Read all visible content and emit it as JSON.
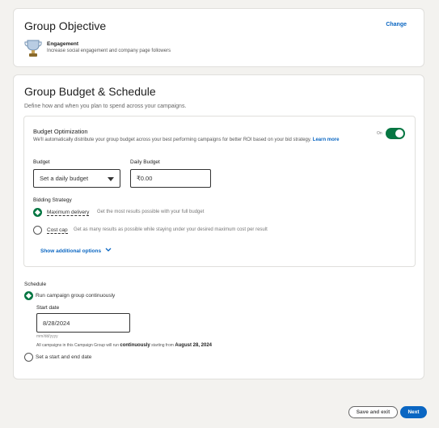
{
  "objective": {
    "title": "Group Objective",
    "change_label": "Change",
    "item_title": "Engagement",
    "item_desc": "Increase social engagement and company page followers"
  },
  "budget": {
    "title": "Group Budget & Schedule",
    "subtitle": "Define how and when you plan to spend across your campaigns.",
    "optimization": {
      "title": "Budget Optimization",
      "desc": "We'll automatically distribute your group budget across your best performing campaigns for better ROI based on your bid strategy.",
      "learn_more": "Learn more",
      "toggle_label": "On",
      "toggle_on": true
    },
    "budget_label": "Budget",
    "budget_select": "Set a daily budget",
    "daily_label": "Daily Budget",
    "daily_value": "₹0.00",
    "bidding_label": "Bidding Strategy",
    "bidding": [
      {
        "name": "Maximum delivery",
        "desc": "Get the most results possible with your full budget",
        "selected": true
      },
      {
        "name": "Cost cap",
        "desc": "Get as many results as possible while staying under your desired maximum cost per result",
        "selected": false
      }
    ],
    "show_options": "Show additional options"
  },
  "schedule": {
    "label": "Schedule",
    "option1": "Run campaign group continuously",
    "start_label": "Start date",
    "start_value": "8/28/2024",
    "date_hint": "mm/dd/yyyy",
    "info_pre": "All campaigns in this Campaign Group will run",
    "info_bold1": "continuously",
    "info_mid": "starting from",
    "info_bold2": "August 28, 2024",
    "option2": "Set a start and end date"
  },
  "footer": {
    "save_exit": "Save and exit",
    "next": "Next"
  },
  "colors": {
    "primary": "#0a66c2",
    "success": "#057642"
  }
}
